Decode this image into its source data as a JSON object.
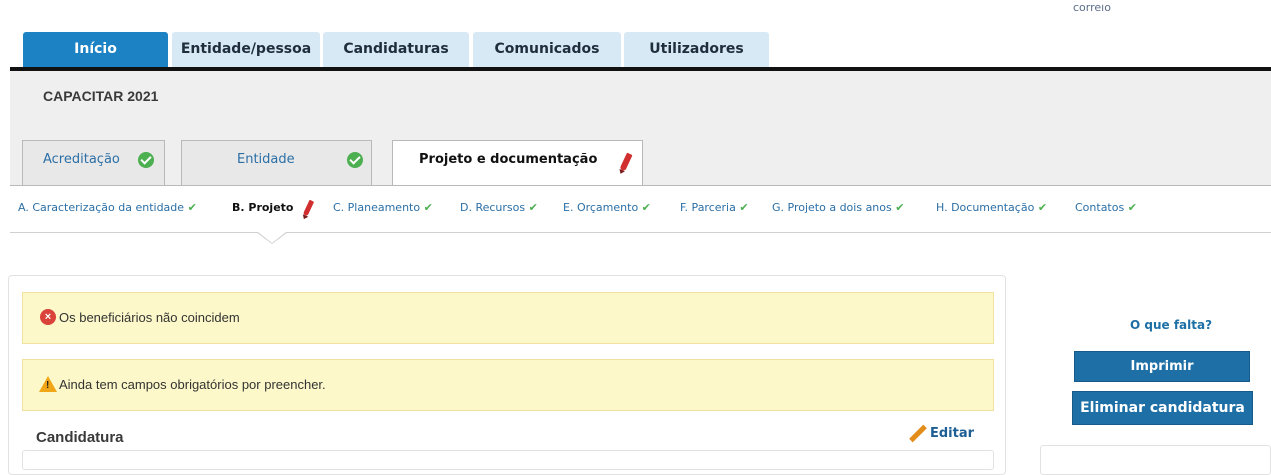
{
  "top_link": "correio",
  "nav_tabs": [
    "Início",
    "Entidade/pessoa",
    "Candidaturas",
    "Comunicados",
    "Utilizadores"
  ],
  "program_title": "CAPACITAR 2021",
  "section_tabs": [
    "Acreditação",
    "Entidade",
    "Projeto e documentação"
  ],
  "subnav": [
    "A. Caracterização da entidade",
    "B. Projeto",
    "C. Planeamento",
    "D. Recursos",
    "E. Orçamento",
    "F. Parceria",
    "G. Projeto a dois anos",
    "H. Documentação",
    "Contatos"
  ],
  "tick_glyph": "✔",
  "alerts": {
    "error": "Os beneficiários não coincidem",
    "warning": "Ainda tem campos obrigatórios por preencher."
  },
  "candidatura": {
    "title": "Candidatura",
    "edit_label": "Editar"
  },
  "sidebar": {
    "missing_link": "O que falta?",
    "print_button": "Imprimir",
    "delete_button": "Eliminar candidatura"
  },
  "colors": {
    "active_tab": "#1d82c3",
    "tab": "#d6e9f5",
    "alert_bg": "#fcf8c9",
    "button": "#1d6fa6",
    "success": "#4caf50",
    "error": "#d9433a"
  },
  "icons": {
    "check": "check-circle-icon",
    "edit": "pencil-icon",
    "error": "error-circle-icon",
    "warning": "warning-triangle-icon"
  }
}
